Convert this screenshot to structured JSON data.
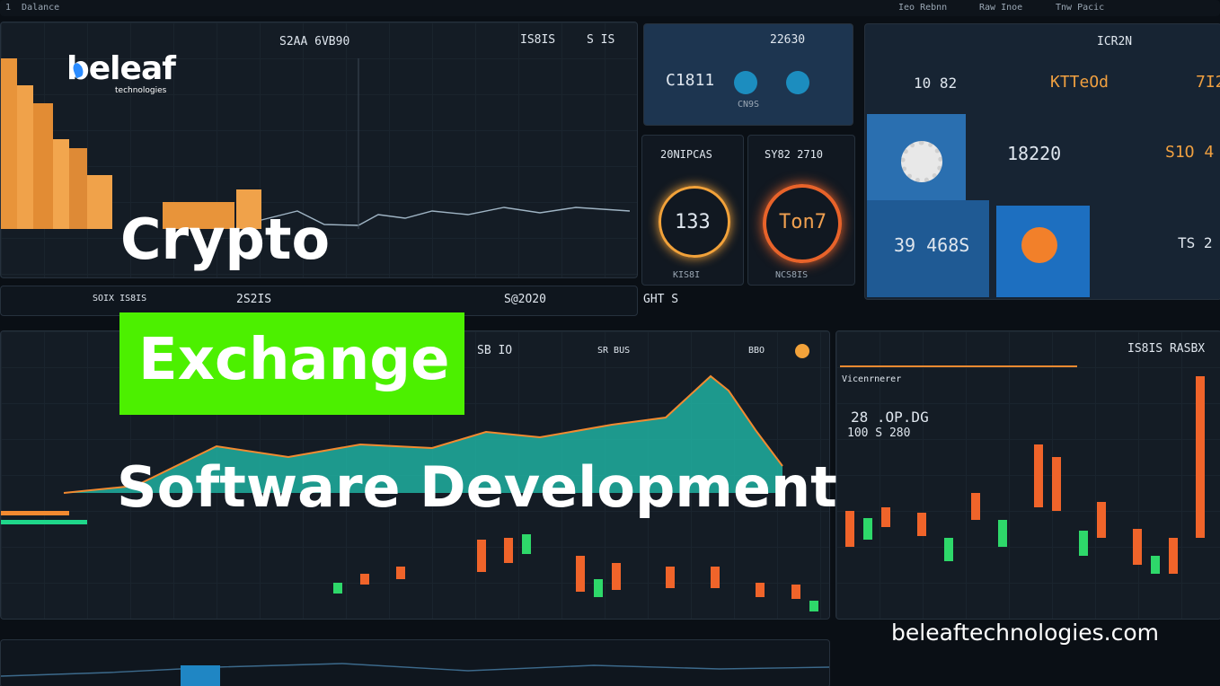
{
  "brand": {
    "name": "beleaf",
    "tagline": "technologies"
  },
  "headline": {
    "line1": "Crypto",
    "line2": "Exchange",
    "line3": "Software Development"
  },
  "website": "beleaftechnologies.com",
  "colors": {
    "highlight": "#4cf000",
    "orange": "#f29a3a",
    "teal": "#1fd6c0",
    "bg": "#0a0f15"
  },
  "dashboard": {
    "top_bar": [
      "1  Dalance",
      "Ieo Rebnn",
      "Raw Inoe",
      "Tnw Pacic"
    ],
    "main_chart": {
      "title": "S2AA 6VB90",
      "value1": "IS8IS",
      "value2": "S IS"
    },
    "stats": {
      "value": "22630",
      "card1": "C1811",
      "card1_sub": "CN9S",
      "gauge1_title": "20NIPCAS",
      "gauge1": "133",
      "gauge2_title": "SY82 2710",
      "gauge2": "Ton7",
      "gauge1_foot": "KIS8I",
      "gauge2_foot": "NCS8IS"
    },
    "right_panel": {
      "h1": "ICR2N",
      "h2": "10 82",
      "h3": "KTTeOd",
      "h4": "7I2",
      "v1": "18220",
      "v2": "S1O 4",
      "v3": "39 468S",
      "v4": "TS 2"
    },
    "mid_strip": {
      "a": "SOIX IS8IS",
      "b": "2S2IS",
      "c": "S@2O20",
      "d": "GHT S"
    },
    "lower_left": {
      "t1": "SB IO",
      "t2": "SR BUS",
      "t3": "BBO"
    },
    "lower_right": {
      "title": "IS8IS RASBX",
      "label": "Vicenrnerer",
      "v1": "28 .OP.DG",
      "v2": "100 S 280"
    }
  }
}
